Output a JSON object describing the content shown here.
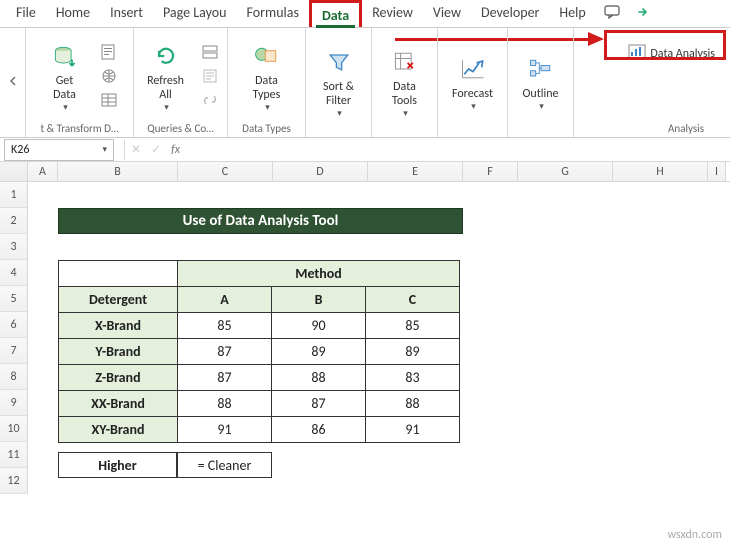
{
  "tabs": {
    "file": "File",
    "home": "Home",
    "insert": "Insert",
    "pagelayout": "Page Layou",
    "formulas": "Formulas",
    "data": "Data",
    "review": "Review",
    "view": "View",
    "developer": "Developer",
    "help": "Help"
  },
  "ribbon": {
    "get_data": "Get\nData",
    "refresh_all": "Refresh\nAll",
    "data_types": "Data\nTypes",
    "sort_filter": "Sort &\nFilter",
    "data_tools": "Data\nTools",
    "forecast": "Forecast",
    "outline": "Outline",
    "data_analysis": "Data Analysis",
    "grp_transform": "t & Transform D…",
    "grp_queries": "Queries & Co…",
    "grp_types": "Data Types",
    "grp_analysis": "Analysis"
  },
  "namebox": "K26",
  "fx": "fx",
  "columns": [
    "A",
    "B",
    "C",
    "D",
    "E",
    "F",
    "G",
    "H",
    "I"
  ],
  "rows": [
    "1",
    "2",
    "3",
    "4",
    "5",
    "6",
    "7",
    "8",
    "9",
    "10",
    "11",
    "12"
  ],
  "sheet": {
    "title": "Use of Data Analysis Tool",
    "method": "Method",
    "detergent": "Detergent",
    "methods": [
      "A",
      "B",
      "C"
    ],
    "brands": [
      "X-Brand",
      "Y-Brand",
      "Z-Brand",
      "XX-Brand",
      "XY-Brand"
    ],
    "data": [
      [
        85,
        90,
        85
      ],
      [
        87,
        89,
        89
      ],
      [
        87,
        88,
        83
      ],
      [
        88,
        87,
        88
      ],
      [
        91,
        86,
        91
      ]
    ],
    "legend_higher": "Higher",
    "legend_cleaner": "= Cleaner"
  },
  "watermark": "wsxdn.com"
}
